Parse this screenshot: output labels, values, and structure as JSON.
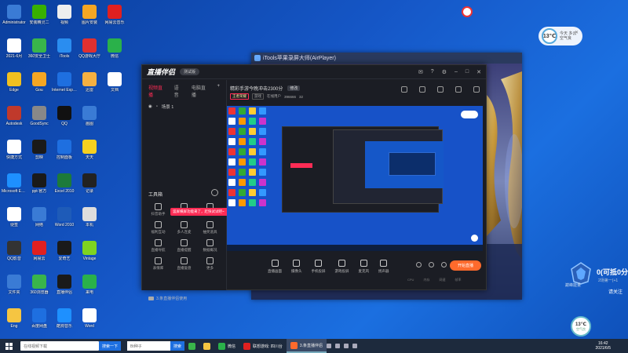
{
  "desktop": {
    "icons": [
      {
        "label": "Administrator",
        "color": "#3a7bd5",
        "icon": "user-folder-icon"
      },
      {
        "label": "安装精灵二",
        "color": "#38b000",
        "icon": "app-icon"
      },
      {
        "label": "视频",
        "color": "#eee",
        "icon": "video-icon"
      },
      {
        "label": "图片安装",
        "color": "#f5a623",
        "icon": "app-icon"
      },
      {
        "label": "网易云音乐",
        "color": "#e02020",
        "icon": "music-icon"
      },
      {
        "label": "2021-6月",
        "color": "#fff",
        "icon": "file-icon"
      },
      {
        "label": "360安全卫士",
        "color": "#39b54a",
        "icon": "shield-icon"
      },
      {
        "label": "iTools",
        "color": "#2a8df0",
        "icon": "app-icon"
      },
      {
        "label": "QQ游戏大厅",
        "color": "#e03030",
        "icon": "game-icon"
      },
      {
        "label": "微信",
        "color": "#2ab14a",
        "icon": "wechat-icon"
      },
      {
        "label": "Edge",
        "color": "#f0c020",
        "icon": "folder-icon"
      },
      {
        "label": "Gou",
        "color": "#f5a623",
        "icon": "app-icon"
      },
      {
        "label": "Internet Explorer",
        "color": "#1e6fe0",
        "icon": "ie-icon"
      },
      {
        "label": "迅雷",
        "color": "#f5b041",
        "icon": "app-icon"
      },
      {
        "label": "文档",
        "color": "#fff",
        "icon": "file-icon"
      },
      {
        "label": "Autodesk",
        "color": "#c0392b",
        "icon": "app-icon"
      },
      {
        "label": "GoodSync",
        "color": "#888",
        "icon": "app-icon"
      },
      {
        "label": "QQ",
        "color": "#111",
        "icon": "qq-icon"
      },
      {
        "label": "画图",
        "color": "#3a7bd5",
        "icon": "paint-icon"
      },
      {
        "label": "",
        "color": "transparent",
        "icon": "empty"
      },
      {
        "label": "快捷方式",
        "color": "#fff",
        "icon": "file-icon"
      },
      {
        "label": "剪映",
        "color": "#1a1a1a",
        "icon": "app-icon"
      },
      {
        "label": "控制面板",
        "color": "#1e6fe0",
        "icon": "control-panel-icon"
      },
      {
        "label": "天天",
        "color": "#f5d020",
        "icon": "app-icon"
      },
      {
        "label": "",
        "color": "transparent",
        "icon": "empty"
      },
      {
        "label": "Microsoft Edge",
        "color": "#1e90ff",
        "icon": "edge-icon"
      },
      {
        "label": "ppt-官方",
        "color": "#1a1a1a",
        "icon": "app-icon"
      },
      {
        "label": "Excel 2010",
        "color": "#1d7a3a",
        "icon": "excel-icon"
      },
      {
        "label": "记录",
        "color": "#222",
        "icon": "app-icon"
      },
      {
        "label": "",
        "color": "transparent",
        "icon": "empty"
      },
      {
        "label": "便签",
        "color": "#fff",
        "icon": "note-icon"
      },
      {
        "label": "网络",
        "color": "#3a7bd5",
        "icon": "network-icon"
      },
      {
        "label": "Word 2010",
        "color": "#1e5bb8",
        "icon": "word-icon"
      },
      {
        "label": "本机",
        "color": "#ddd",
        "icon": "computer-icon"
      },
      {
        "label": "",
        "color": "transparent",
        "icon": "empty"
      },
      {
        "label": "QQ影音",
        "color": "#333",
        "icon": "app-icon"
      },
      {
        "label": "网易云",
        "color": "#e02020",
        "icon": "music-icon"
      },
      {
        "label": "爱奇艺",
        "color": "#1a1a1a",
        "icon": "video-icon"
      },
      {
        "label": "Vintage",
        "color": "#7ed321",
        "icon": "app-icon"
      },
      {
        "label": "",
        "color": "transparent",
        "icon": "empty"
      },
      {
        "label": "文件夹",
        "color": "#3a7bd5",
        "icon": "folder-icon"
      },
      {
        "label": "360浏览器",
        "color": "#39b54a",
        "icon": "browser-icon"
      },
      {
        "label": "直播伴侣",
        "color": "#1a1a1a",
        "icon": "app-icon"
      },
      {
        "label": "来电",
        "color": "#2ab14a",
        "icon": "app-icon"
      },
      {
        "label": "",
        "color": "transparent",
        "icon": "empty"
      },
      {
        "label": "Eng",
        "color": "#f5c542",
        "icon": "folder-icon"
      },
      {
        "label": "百度网盘",
        "color": "#1e6fe0",
        "icon": "cloud-icon"
      },
      {
        "label": "酷狗音乐",
        "color": "#1e90ff",
        "icon": "music-icon"
      },
      {
        "label": "Word",
        "color": "#fff",
        "icon": "file-icon"
      },
      {
        "label": "",
        "color": "transparent",
        "icon": "empty"
      }
    ]
  },
  "weather_pill": {
    "value": "13",
    "unit": "℃",
    "text1": "今天 多云",
    "text2": "空气良"
  },
  "airplayer": {
    "title": "iTools苹果录屏大师(AirPlayer)"
  },
  "game": {
    "score": "0(可抵0分",
    "score_sub": "2场第一(+1",
    "notice": "请关注",
    "badge_label": "巅峰能量"
  },
  "weather_circle": {
    "value": "13",
    "unit": "℃",
    "sub": "空气良"
  },
  "app": {
    "logo": "直播伴侣",
    "version": "测试版",
    "left_tabs": {
      "tab1": "视频直播",
      "tab2": "语音",
      "tab3": "电脑直播"
    },
    "scene": "场景 1",
    "tools_title": "工具箱",
    "tools": [
      {
        "label": "抖音助手"
      },
      {
        "label": "连线主播"
      },
      {
        "label": "主播任务"
      },
      {
        "label": "福利互动"
      },
      {
        "label": "多人连麦"
      },
      {
        "label": "抽奖道具"
      },
      {
        "label": "直播导航"
      },
      {
        "label": "直播提醒"
      },
      {
        "label": "数据概况"
      },
      {
        "label": "表情库"
      },
      {
        "label": "直播复盘"
      },
      {
        "label": "更多"
      }
    ],
    "toast": "竖屏横屏功能来了，赶快试试吧~",
    "left_footer": "3.条直播伴侣使用",
    "room_title": "精彩手游今晚冲击2300分",
    "room_edit": "修改",
    "tags": {
      "t1": "王者荣耀",
      "t2": "游戏",
      "t3": "在线用户",
      "t4": "396666",
      "t5": "32"
    },
    "bottom_tools": [
      {
        "label": "直播画面"
      },
      {
        "label": "摄像头"
      },
      {
        "label": "手机投屏"
      },
      {
        "label": "游戏投屏"
      },
      {
        "label": "麦克风"
      },
      {
        "label": "扬声器"
      }
    ],
    "start_live": "开始直播",
    "stats": {
      "s1": "CPU",
      "s2": "内存",
      "s3": "网速",
      "s4": "帧率"
    }
  },
  "taskbar": {
    "search_placeholder": "在线视频下载",
    "search_btn": "搜索一下",
    "search2_placeholder": "Bt种子",
    "search2_btn": "搜索",
    "apps": [
      {
        "label": "微信",
        "color": "#2ab14a"
      },
      {
        "label": "联想游戏: 四川台",
        "color": "#e02020"
      },
      {
        "label": "3.条直播伴侣",
        "color": "#fe6a2c"
      }
    ],
    "time": "16:42",
    "date": "2021/6/5"
  }
}
